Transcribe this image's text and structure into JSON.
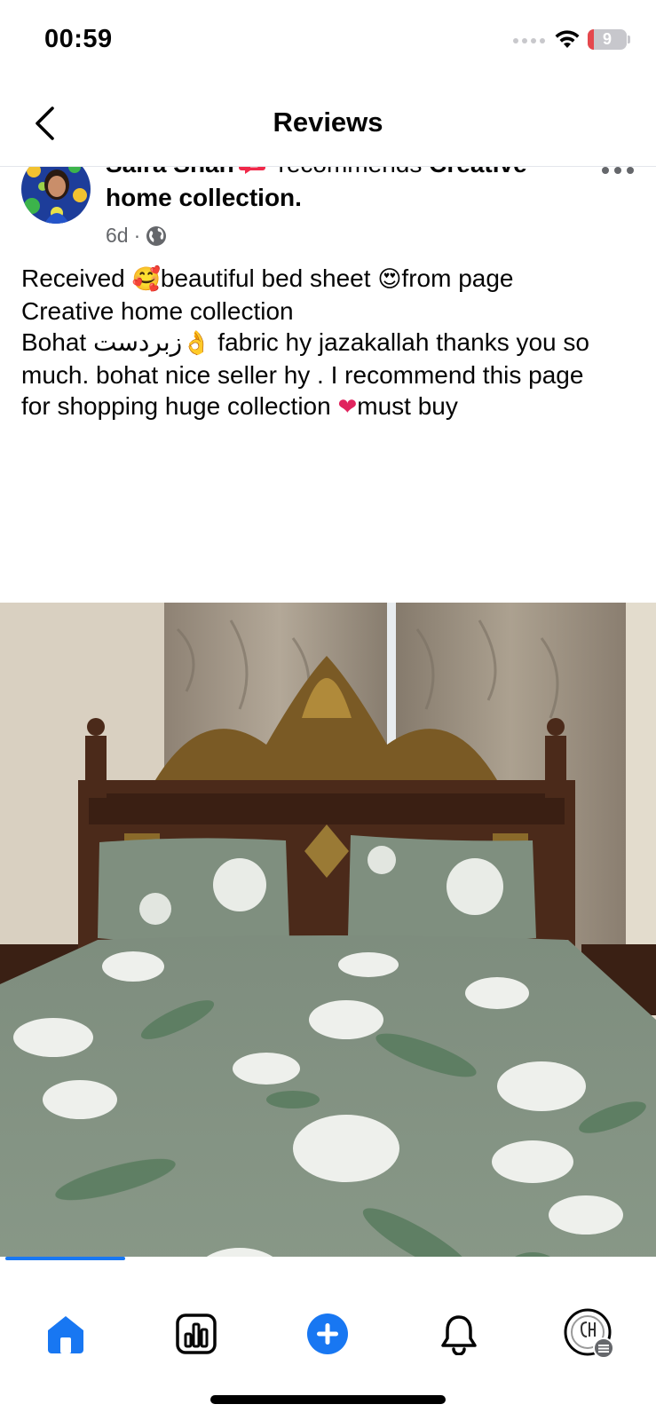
{
  "status_bar": {
    "time": "00:59",
    "battery_level": "9",
    "battery_fraction": 0.09
  },
  "nav": {
    "title": "Reviews"
  },
  "post": {
    "author": "Saira Shah",
    "recommends_text": "recommends",
    "page_name": "Creative home collection.",
    "timestamp": "6d",
    "separator": "·",
    "audience_icon": "globe-icon",
    "text_lines": [
      {
        "before": "Received ",
        "emoji1": "🥰",
        "middle": "beautiful bed sheet ",
        "emoji2": "😍",
        "after": "from page"
      },
      "Creative home collection",
      {
        "before": "Bohat زبردست",
        "emoji": "👌",
        "after": " fabric hy jazakallah thanks you so"
      },
      "much. bohat nice seller hy . I recommend this page",
      {
        "before": "for shopping huge collection ",
        "emoji": "❤",
        "after": "must buy"
      }
    ],
    "photo_alt": "bed-with-floral-bedsheet"
  },
  "bottom_nav": {
    "items": [
      {
        "name": "home",
        "icon": "home-icon",
        "active": true
      },
      {
        "name": "dashboard",
        "icon": "bar-chart-icon",
        "active": false
      },
      {
        "name": "create",
        "icon": "plus-circle-icon",
        "active": false
      },
      {
        "name": "notifications",
        "icon": "bell-icon",
        "active": false
      },
      {
        "name": "profile",
        "icon": "page-avatar-icon",
        "active": false
      }
    ]
  },
  "colors": {
    "accent": "#1877f2",
    "text_primary": "#050505",
    "text_secondary": "#65676b",
    "battery_low": "#e5484d"
  }
}
